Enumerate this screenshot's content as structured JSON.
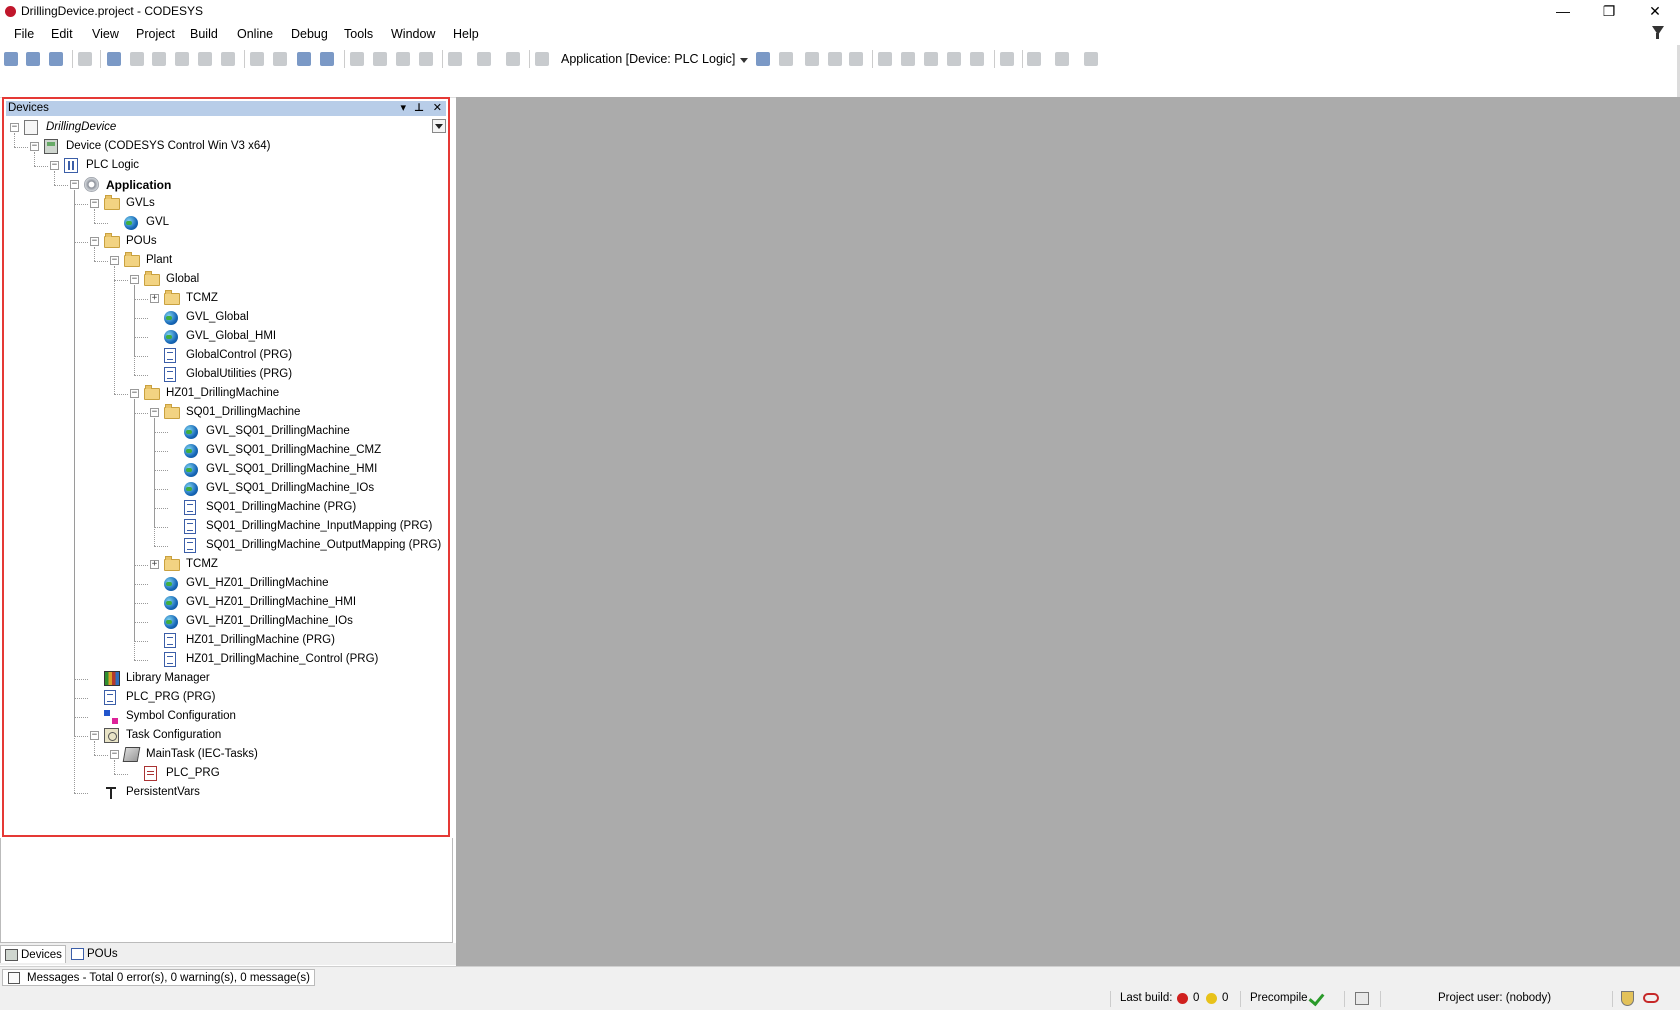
{
  "window": {
    "title": "DrillingDevice.project - CODESYS",
    "controls": {
      "minimize": "—",
      "restore": "❐",
      "close": "✕"
    }
  },
  "menu": [
    "File",
    "Edit",
    "View",
    "Project",
    "Build",
    "Online",
    "Debug",
    "Tools",
    "Window",
    "Help"
  ],
  "toolbar": {
    "active_application": "Application [Device: PLC Logic]"
  },
  "devices_panel": {
    "title": "Devices",
    "controls": {
      "dropdown": "▾",
      "pin": "⊥",
      "close": "✕"
    },
    "tree": [
      {
        "label": "DrillingDevice",
        "icon": "project-icon",
        "style": "italic",
        "expanded": true
      },
      {
        "label": "Device (CODESYS Control Win V3 x64)",
        "icon": "device-icon",
        "expanded": true
      },
      {
        "label": "PLC Logic",
        "icon": "plc-logic-icon",
        "expanded": true
      },
      {
        "label": "Application",
        "icon": "application-icon",
        "style": "bold",
        "expanded": true
      },
      {
        "label": "GVLs",
        "icon": "folder-icon",
        "expanded": true
      },
      {
        "label": "GVL",
        "icon": "gvl-icon"
      },
      {
        "label": "POUs",
        "icon": "folder-icon",
        "expanded": true
      },
      {
        "label": "Plant",
        "icon": "folder-icon",
        "expanded": true
      },
      {
        "label": "Global",
        "icon": "folder-icon",
        "expanded": true
      },
      {
        "label": "TCMZ",
        "icon": "folder-icon",
        "expanded": false
      },
      {
        "label": "GVL_Global",
        "icon": "gvl-icon"
      },
      {
        "label": "GVL_Global_HMI",
        "icon": "gvl-icon"
      },
      {
        "label": "GlobalControl (PRG)",
        "icon": "program-icon"
      },
      {
        "label": "GlobalUtilities (PRG)",
        "icon": "program-icon"
      },
      {
        "label": "HZ01_DrillingMachine",
        "icon": "folder-icon",
        "expanded": true
      },
      {
        "label": "SQ01_DrillingMachine",
        "icon": "folder-icon",
        "expanded": true
      },
      {
        "label": "GVL_SQ01_DrillingMachine",
        "icon": "gvl-icon"
      },
      {
        "label": "GVL_SQ01_DrillingMachine_CMZ",
        "icon": "gvl-icon"
      },
      {
        "label": "GVL_SQ01_DrillingMachine_HMI",
        "icon": "gvl-icon"
      },
      {
        "label": "GVL_SQ01_DrillingMachine_IOs",
        "icon": "gvl-icon"
      },
      {
        "label": "SQ01_DrillingMachine (PRG)",
        "icon": "program-icon"
      },
      {
        "label": "SQ01_DrillingMachine_InputMapping (PRG)",
        "icon": "program-icon"
      },
      {
        "label": "SQ01_DrillingMachine_OutputMapping (PRG)",
        "icon": "program-icon"
      },
      {
        "label": "TCMZ",
        "icon": "folder-icon",
        "expanded": false
      },
      {
        "label": "GVL_HZ01_DrillingMachine",
        "icon": "gvl-icon"
      },
      {
        "label": "GVL_HZ01_DrillingMachine_HMI",
        "icon": "gvl-icon"
      },
      {
        "label": "GVL_HZ01_DrillingMachine_IOs",
        "icon": "gvl-icon"
      },
      {
        "label": "HZ01_DrillingMachine (PRG)",
        "icon": "program-icon"
      },
      {
        "label": "HZ01_DrillingMachine_Control (PRG)",
        "icon": "program-icon"
      },
      {
        "label": "Library Manager",
        "icon": "library-manager-icon"
      },
      {
        "label": "PLC_PRG (PRG)",
        "icon": "program-icon"
      },
      {
        "label": "Symbol Configuration",
        "icon": "symbol-configuration-icon"
      },
      {
        "label": "Task Configuration",
        "icon": "task-configuration-icon",
        "expanded": true
      },
      {
        "label": "MainTask (IEC-Tasks)",
        "icon": "main-task-icon",
        "expanded": true
      },
      {
        "label": "PLC_PRG",
        "icon": "program-call-icon"
      },
      {
        "label": "PersistentVars",
        "icon": "persistent-vars-icon"
      }
    ]
  },
  "bottom_tabs": [
    {
      "label": "Devices",
      "active": true
    },
    {
      "label": "POUs",
      "active": false
    }
  ],
  "messages": {
    "label": "Messages - Total 0 error(s), 0 warning(s), 0 message(s)"
  },
  "status_bar": {
    "last_build_label": "Last build:",
    "errors": "0",
    "warnings": "0",
    "precompile_label": "Precompile",
    "project_user": "Project user: (nobody)"
  }
}
